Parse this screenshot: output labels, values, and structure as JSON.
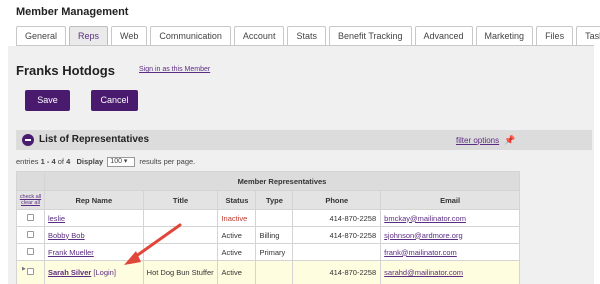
{
  "page_title": "Member Management",
  "tabs": [
    {
      "label": "General"
    },
    {
      "label": "Reps",
      "active": true
    },
    {
      "label": "Web"
    },
    {
      "label": "Communication"
    },
    {
      "label": "Account"
    },
    {
      "label": "Stats"
    },
    {
      "label": "Benefit Tracking"
    },
    {
      "label": "Advanced"
    },
    {
      "label": "Marketing"
    },
    {
      "label": "Files"
    },
    {
      "label": "Tasks"
    }
  ],
  "member": {
    "name": "Franks Hotdogs",
    "sign_in_link": "Sign in as this Member"
  },
  "buttons": {
    "save": "Save",
    "cancel": "Cancel"
  },
  "list": {
    "title": "List of Representatives",
    "filter_link": "filter options",
    "entries_prefix": "entries",
    "entries_range": "1 - 4",
    "entries_of": "of",
    "entries_total": "4",
    "display_label": "Display",
    "display_value": "100",
    "display_suffix": "results per page."
  },
  "table": {
    "group_header": "Member Representatives",
    "check_all": "check all",
    "clear_all": "clear all",
    "columns": {
      "rep_name": "Rep Name",
      "title": "Title",
      "status": "Status",
      "type": "Type",
      "phone": "Phone",
      "email": "Email"
    },
    "rows": [
      {
        "name": "leslie",
        "login": "",
        "title": "",
        "status": "Inactive",
        "type": "",
        "phone": "414-870-2258",
        "email": "bmckay@mailinator.com"
      },
      {
        "name": "Bobby Bob",
        "login": "",
        "title": "",
        "status": "Active",
        "type": "Billing",
        "phone": "414-870-2258",
        "email": "sjohnson@ardmore.org"
      },
      {
        "name": "Frank Mueller",
        "login": "",
        "title": "",
        "status": "Active",
        "type": "Primary",
        "phone": "",
        "email": "frank@mailinator.com"
      },
      {
        "name": "Sarah Silver",
        "login": "[Login]",
        "title": "Hot Dog Bun Stuffer",
        "status": "Active",
        "type": "",
        "phone": "414-870-2258",
        "email": "sarahd@mailinator.com"
      }
    ]
  },
  "colors": {
    "accent": "#4a1a6e",
    "link": "#5b2d82",
    "inactive": "#c0392b",
    "highlight_row": "#fffde0",
    "arrow": "#e0463a"
  }
}
